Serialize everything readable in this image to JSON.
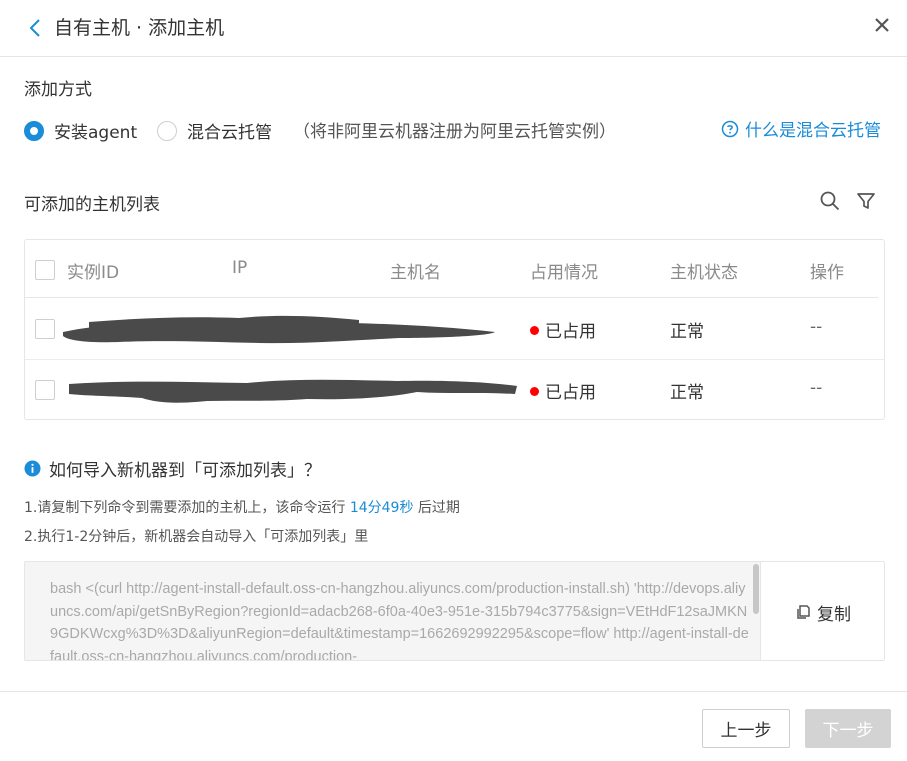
{
  "header": {
    "title": "自有主机 · 添加主机"
  },
  "add_method": {
    "label": "添加方式",
    "options": [
      {
        "label": "安装agent",
        "checked": true
      },
      {
        "label": "混合云托管",
        "checked": false
      }
    ],
    "hint": "（将非阿里云机器注册为阿里云托管实例）",
    "help_link": "什么是混合云托管"
  },
  "host_list": {
    "title": "可添加的主机列表",
    "columns": [
      "实例ID",
      "IP",
      "主机名",
      "占用情况",
      "主机状态",
      "操作"
    ],
    "rows": [
      {
        "usage": "已占用",
        "status": "正常",
        "action": "--"
      },
      {
        "usage": "已占用",
        "status": "正常",
        "action": "--"
      }
    ]
  },
  "import_guide": {
    "title": "如何导入新机器到「可添加列表」？",
    "step1_prefix": "1.请复制下列命令到需要添加的主机上，该命令运行 ",
    "step1_countdown": "14分49秒",
    "step1_suffix": " 后过期",
    "step2": "2.执行1-2分钟后，新机器会自动导入「可添加列表」里",
    "command": "bash <(curl http://agent-install-default.oss-cn-hangzhou.aliyuncs.com/production-install.sh) 'http://devops.aliyuncs.com/api/getSnByRegion?regionId=adacb268-6f0a-40e3-951e-315b794c3775&sign=VEtHdF12saJMKN9GDKWcxg%3D%3D&aliyunRegion=default&timestamp=1662692992295&scope=flow' http://agent-install-default.oss-cn-hangzhou.aliyuncs.com/production-",
    "copy_label": "复制"
  },
  "footer": {
    "prev_label": "上一步",
    "next_label": "下一步"
  },
  "colors": {
    "accent": "#1a8cd8",
    "status_dot": "#ff0000",
    "disabled": "#d3d3d3"
  }
}
